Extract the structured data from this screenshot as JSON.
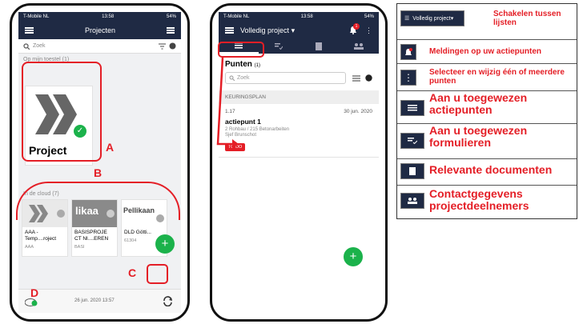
{
  "phone1": {
    "status": {
      "carrier": "T-Mobile NL",
      "time": "13:58",
      "battery": "54%"
    },
    "title": "Projecten",
    "search_placeholder": "Zoek",
    "local_section": "Op mijn toestel (1)",
    "local_project_title": "Project",
    "cloud_section": "In de cloud (7)",
    "cloud_cards": [
      {
        "name": "AAA - Temp....roject",
        "sub": "AAA",
        "thumb": ""
      },
      {
        "name": "BASISPROJE CT NI....EREN",
        "sub": "BASI",
        "thumb": "likaa"
      },
      {
        "name": "DLD Götti...",
        "sub": "61304",
        "thumb": "Pellikaan"
      }
    ],
    "sync_date": "26 jun. 2020 13:57",
    "fab": "+",
    "labels": {
      "a": "A",
      "b": "B",
      "c": "C",
      "d": "D"
    }
  },
  "phone2": {
    "status": {
      "carrier": "T-Mobile NL",
      "time": "13:58",
      "battery": "54%"
    },
    "title": "Volledig project",
    "notification_count": "1",
    "section_title": "Punten",
    "section_count": "(1)",
    "search_placeholder": "Zoek",
    "group_header": "KEURINGSPLAN",
    "item": {
      "code": "1.17",
      "date": "30 jun. 2020",
      "title": "actiepunt 1",
      "location": "2 Rohbau / 215 Betonarbeiten",
      "person": "Sjef Brunschot",
      "status": "TO DO"
    },
    "fab": "+"
  },
  "legend": [
    {
      "icon": "Volledig project",
      "text": "Schakelen tussen lijsten"
    },
    {
      "icon": "bell-icon",
      "text": "Meldingen op uw actiepunten"
    },
    {
      "icon": "more-vertical-icon",
      "text": "Selecteer en wijzig één of meerdere punten"
    },
    {
      "icon": "list-icon",
      "text": "Aan u toegewezen actiepunten"
    },
    {
      "icon": "form-icon",
      "text": "Aan u toegewezen formulieren"
    },
    {
      "icon": "document-icon",
      "text": "Relevante documenten"
    },
    {
      "icon": "contacts-icon",
      "text": "Contactgegevens projectdeelnemers"
    }
  ],
  "colors": {
    "navy": "#1f2a44",
    "red": "#e41e26",
    "green": "#1bb24b"
  }
}
